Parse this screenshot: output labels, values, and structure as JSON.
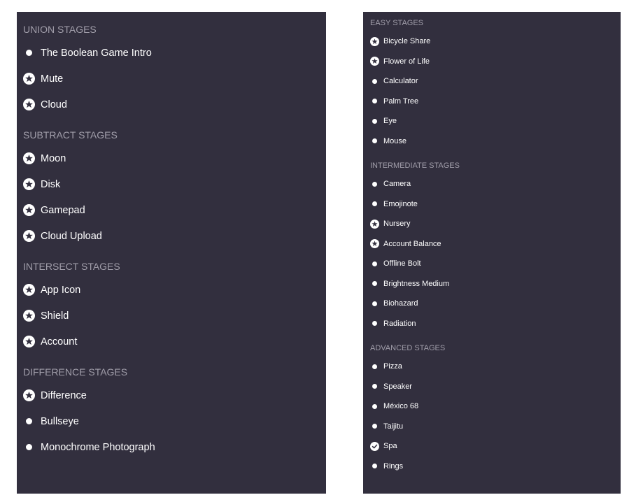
{
  "colors": {
    "panel_bg": "#322f3e",
    "section_title": "#a19eaa",
    "text": "#ffffff"
  },
  "left_panel": {
    "sections": [
      {
        "title": "UNION STAGES",
        "items": [
          {
            "label": "The Boolean Game Intro",
            "icon": "dot-icon"
          },
          {
            "label": "Mute",
            "icon": "star-badge-icon"
          },
          {
            "label": "Cloud",
            "icon": "star-badge-icon"
          }
        ]
      },
      {
        "title": "SUBTRACT STAGES",
        "items": [
          {
            "label": "Moon",
            "icon": "star-badge-icon"
          },
          {
            "label": "Disk",
            "icon": "star-badge-icon"
          },
          {
            "label": "Gamepad",
            "icon": "star-badge-icon"
          },
          {
            "label": "Cloud Upload",
            "icon": "star-badge-icon"
          }
        ]
      },
      {
        "title": "INTERSECT STAGES",
        "items": [
          {
            "label": "App Icon",
            "icon": "star-badge-icon"
          },
          {
            "label": "Shield",
            "icon": "star-badge-icon"
          },
          {
            "label": "Account",
            "icon": "star-badge-icon"
          }
        ]
      },
      {
        "title": "DIFFERENCE STAGES",
        "items": [
          {
            "label": "Difference",
            "icon": "star-badge-icon"
          },
          {
            "label": "Bullseye",
            "icon": "dot-icon"
          },
          {
            "label": "Monochrome Photograph",
            "icon": "dot-icon"
          }
        ]
      }
    ]
  },
  "right_panel": {
    "sections": [
      {
        "title": "EASY STAGES",
        "items": [
          {
            "label": "Bicycle Share",
            "icon": "star-badge-icon"
          },
          {
            "label": "Flower of Life",
            "icon": "star-badge-icon"
          },
          {
            "label": "Calculator",
            "icon": "dot-icon"
          },
          {
            "label": "Palm Tree",
            "icon": "dot-icon"
          },
          {
            "label": "Eye",
            "icon": "dot-icon"
          },
          {
            "label": "Mouse",
            "icon": "dot-icon"
          }
        ]
      },
      {
        "title": "INTERMEDIATE STAGES",
        "items": [
          {
            "label": "Camera",
            "icon": "dot-icon"
          },
          {
            "label": "Emojinote",
            "icon": "dot-icon"
          },
          {
            "label": "Nursery",
            "icon": "star-badge-icon"
          },
          {
            "label": "Account Balance",
            "icon": "star-badge-icon"
          },
          {
            "label": "Offline Bolt",
            "icon": "dot-icon"
          },
          {
            "label": "Brightness Medium",
            "icon": "dot-icon"
          },
          {
            "label": "Biohazard",
            "icon": "dot-icon"
          },
          {
            "label": "Radiation",
            "icon": "dot-icon"
          }
        ]
      },
      {
        "title": "ADVANCED STAGES",
        "items": [
          {
            "label": "Pizza",
            "icon": "dot-icon"
          },
          {
            "label": "Speaker",
            "icon": "dot-icon"
          },
          {
            "label": "México 68",
            "icon": "dot-icon"
          },
          {
            "label": "Taijitu",
            "icon": "dot-icon"
          },
          {
            "label": "Spa",
            "icon": "check-circle-icon"
          },
          {
            "label": "Rings",
            "icon": "dot-icon"
          }
        ]
      }
    ]
  }
}
